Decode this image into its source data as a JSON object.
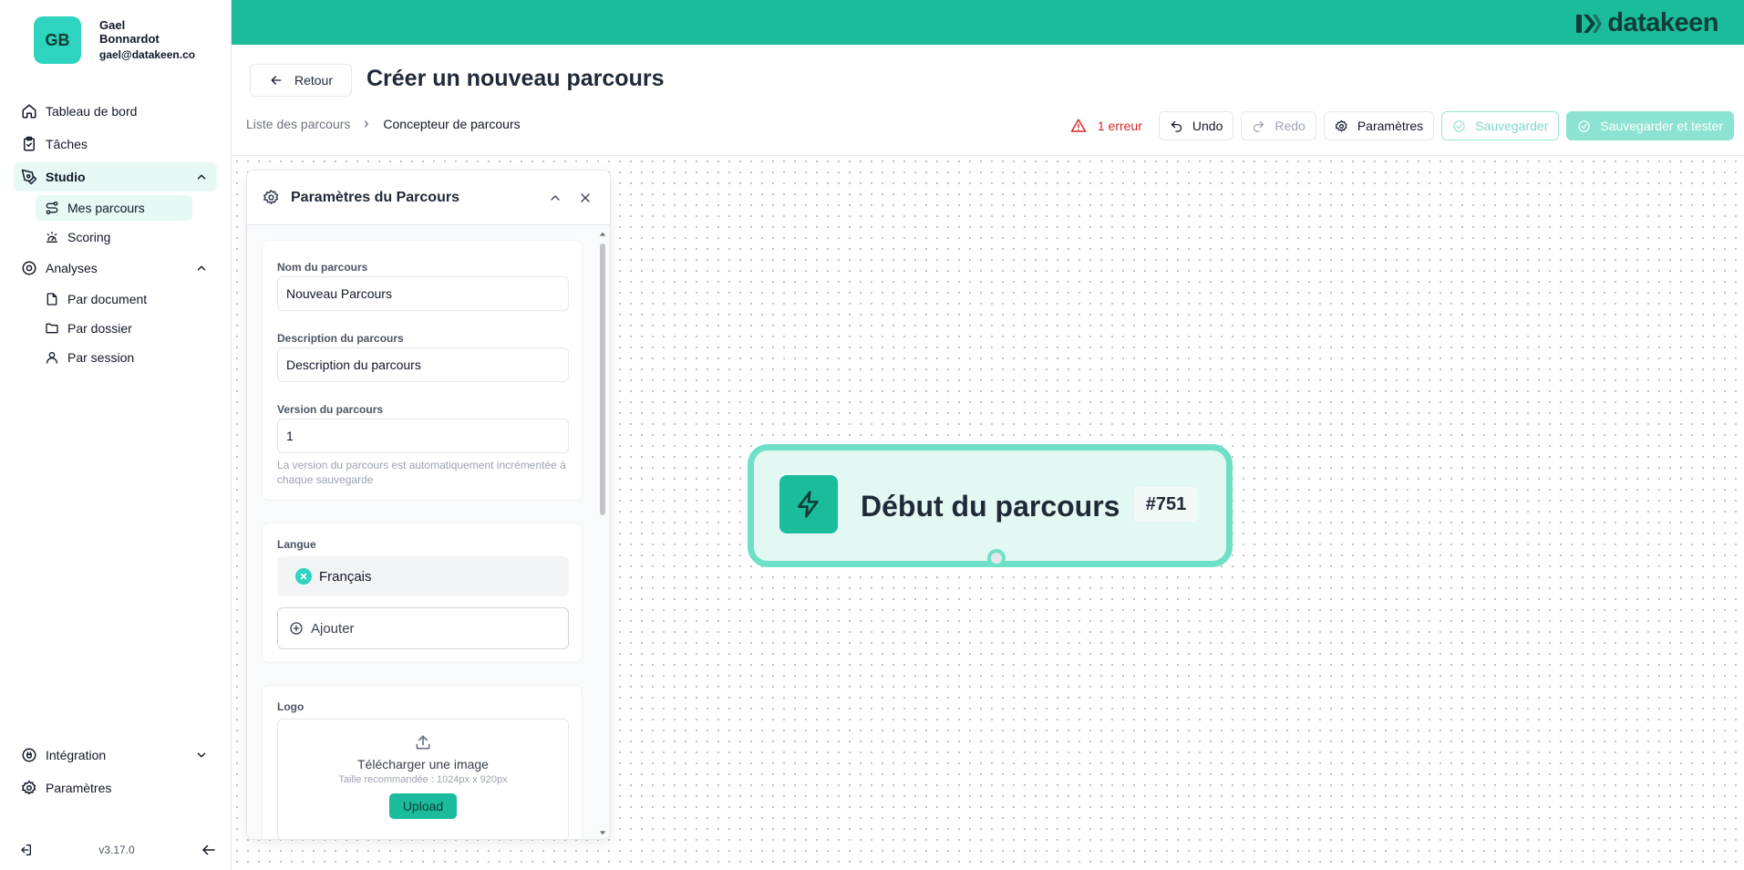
{
  "user": {
    "initials": "GB",
    "first_name": "Gael",
    "last_name": "Bonnardot",
    "email": "gael@datakeen.co"
  },
  "sidebar": {
    "items": [
      {
        "label": "Tableau de bord",
        "icon": "home-icon"
      },
      {
        "label": "Tâches",
        "icon": "clipboard-check-icon"
      },
      {
        "label": "Studio",
        "icon": "pen-tool-icon",
        "expanded": true
      },
      {
        "label": "Analyses",
        "icon": "target-icon",
        "expanded": true
      }
    ],
    "studio_sub": [
      {
        "label": "Mes parcours",
        "icon": "route-icon",
        "active": true
      },
      {
        "label": "Scoring",
        "icon": "gauge-icon"
      }
    ],
    "analyses_sub": [
      {
        "label": "Par document",
        "icon": "file-icon"
      },
      {
        "label": "Par dossier",
        "icon": "folder-icon"
      },
      {
        "label": "Par session",
        "icon": "user-icon"
      }
    ],
    "bottom": [
      {
        "label": "Intégration",
        "icon": "plug-icon"
      },
      {
        "label": "Paramètres",
        "icon": "gear-icon"
      }
    ],
    "version": "v3.17.0"
  },
  "brand": {
    "name": "datakeen",
    "color": "#1abc9c"
  },
  "header": {
    "back_label": "Retour",
    "title": "Créer un nouveau parcours",
    "breadcrumb": [
      "Liste des parcours",
      "Concepteur de parcours"
    ]
  },
  "toolbar": {
    "error_label": "1 erreur",
    "undo_label": "Undo",
    "redo_label": "Redo",
    "settings_label": "Paramètres",
    "save_label": "Sauvegarder",
    "save_test_label": "Sauvegarder et tester"
  },
  "panel": {
    "title": "Paramètres du Parcours",
    "name_label": "Nom du parcours",
    "name_value": "Nouveau Parcours",
    "desc_label": "Description du parcours",
    "desc_value": "Description du parcours",
    "version_label": "Version du parcours",
    "version_value": "1",
    "version_help": "La version du parcours est automatiquement incrémentée à chaque sauvegarde",
    "language_label": "Langue",
    "language_value": "Français",
    "add_label": "Ajouter",
    "logo_label": "Logo",
    "upload_title": "Télécharger une image",
    "upload_hint": "Taille recommandée : 1024px x 920px",
    "upload_button": "Upload"
  },
  "canvas": {
    "start_node": {
      "label": "Début du parcours",
      "id_badge": "#751"
    }
  }
}
